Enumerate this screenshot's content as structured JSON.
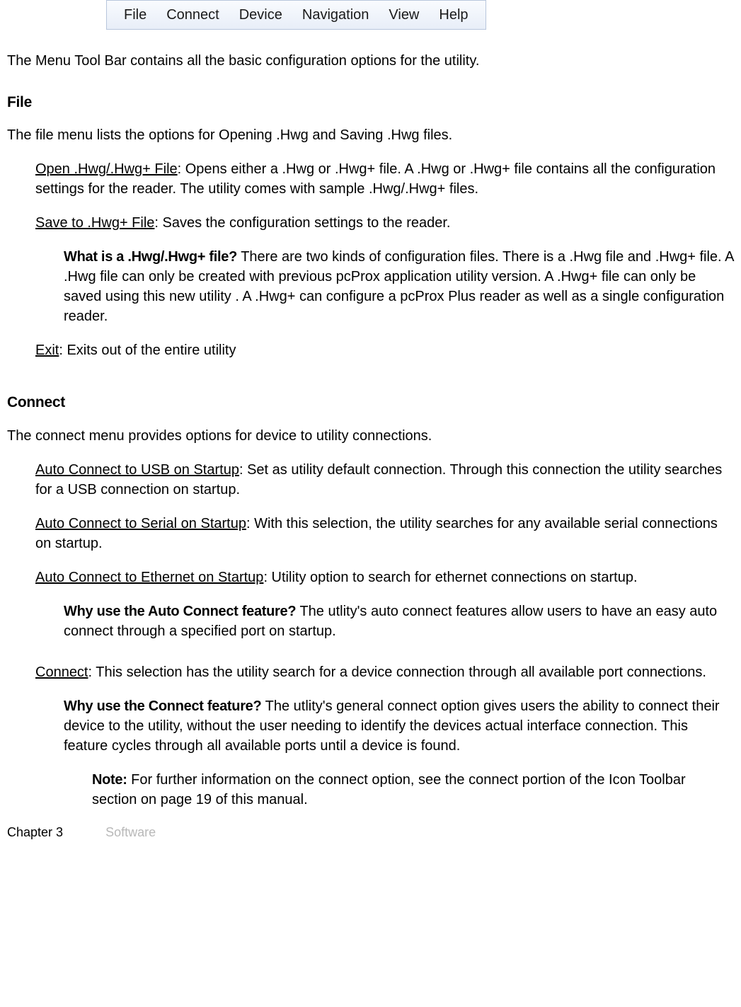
{
  "menubar": {
    "items": [
      "File",
      "Connect",
      "Device",
      "Navigation",
      "View",
      "Help"
    ]
  },
  "intro": "The Menu Tool Bar contains all the basic configuration options for the utility.",
  "file": {
    "heading": "File",
    "desc": "The file menu lists the options for Opening .Hwg and Saving .Hwg files.",
    "open_term": "Open .Hwg/.Hwg+ File",
    "open_body": ": Opens either a .Hwg or .Hwg+ file.  A .Hwg or .Hwg+ file contains all the configuration settings for the reader. The utility comes with sample .Hwg/.Hwg+ files.",
    "save_term": "Save to .Hwg+ File",
    "save_body": ": Saves the configuration settings to the reader.",
    "what_q": "What is a .Hwg/.Hwg+ file?",
    "what_body": " There are two kinds of configuration files. There is a .Hwg file and .Hwg+ file. A .Hwg file can only be created with previous pcProx application utility version. A .Hwg+ file can only be saved using this new utility . A .Hwg+ can configure a pcProx Plus reader as well as a single configuration reader.",
    "exit_term": "Exit",
    "exit_body": ": Exits out of the entire utility"
  },
  "connect": {
    "heading": "Connect",
    "desc": "The connect menu provides options for device to utility connections.",
    "usb_term": "Auto Connect to USB on Startup",
    "usb_body": ": Set as utility default connection. Through this connection the utility searches for a USB connection on startup.",
    "serial_term": "Auto Connect to Serial on Startup",
    "serial_body": ": With this selection, the utility searches for any available serial connections on startup.",
    "eth_term": "Auto Connect to Ethernet on Startup",
    "eth_body": ":  Utility option to search for ethernet connections on startup.",
    "why_auto_q": "Why use the Auto Connect feature?",
    "why_auto_body": " The utlity's auto connect features allow users to have an easy auto connect through a specified port on startup.",
    "connect_term": "Connect",
    "connect_body": ": This selection has the utility search for a device connection through all available port connections.",
    "why_conn_q": "Why use the Connect feature?",
    "why_conn_body": " The utlity's general connect option gives users the ability to connect their device to the utility, without the user needing to identify the devices actual interface connection. This feature cycles through all available ports until a device is found.",
    "note_label": "Note:",
    "note_body": " For further information on the connect option, see the connect portion of the Icon Toolbar section on page 19 of this manual."
  },
  "footer": {
    "chapter": "Chapter 3",
    "section": "Software"
  }
}
